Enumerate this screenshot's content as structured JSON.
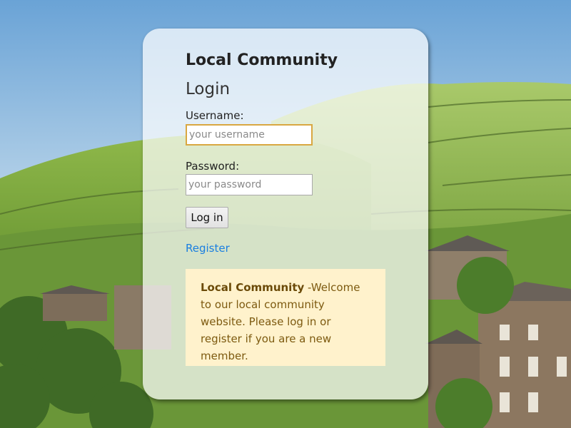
{
  "header": {
    "site_title": "Local Community",
    "page_title": "Login"
  },
  "form": {
    "username_label": "Username:",
    "username_placeholder": "your username",
    "password_label": "Password:",
    "password_placeholder": "your password",
    "login_button": "Log in",
    "register_link": "Register"
  },
  "info": {
    "strong": "Local Community",
    "text": " -Welcome to our local community website. Please log in or register if you are a new member."
  },
  "colors": {
    "link": "#1a7fe0",
    "info_background": "#fff2cc",
    "info_text": "#7d5a10",
    "focus_border": "#d9a741"
  }
}
